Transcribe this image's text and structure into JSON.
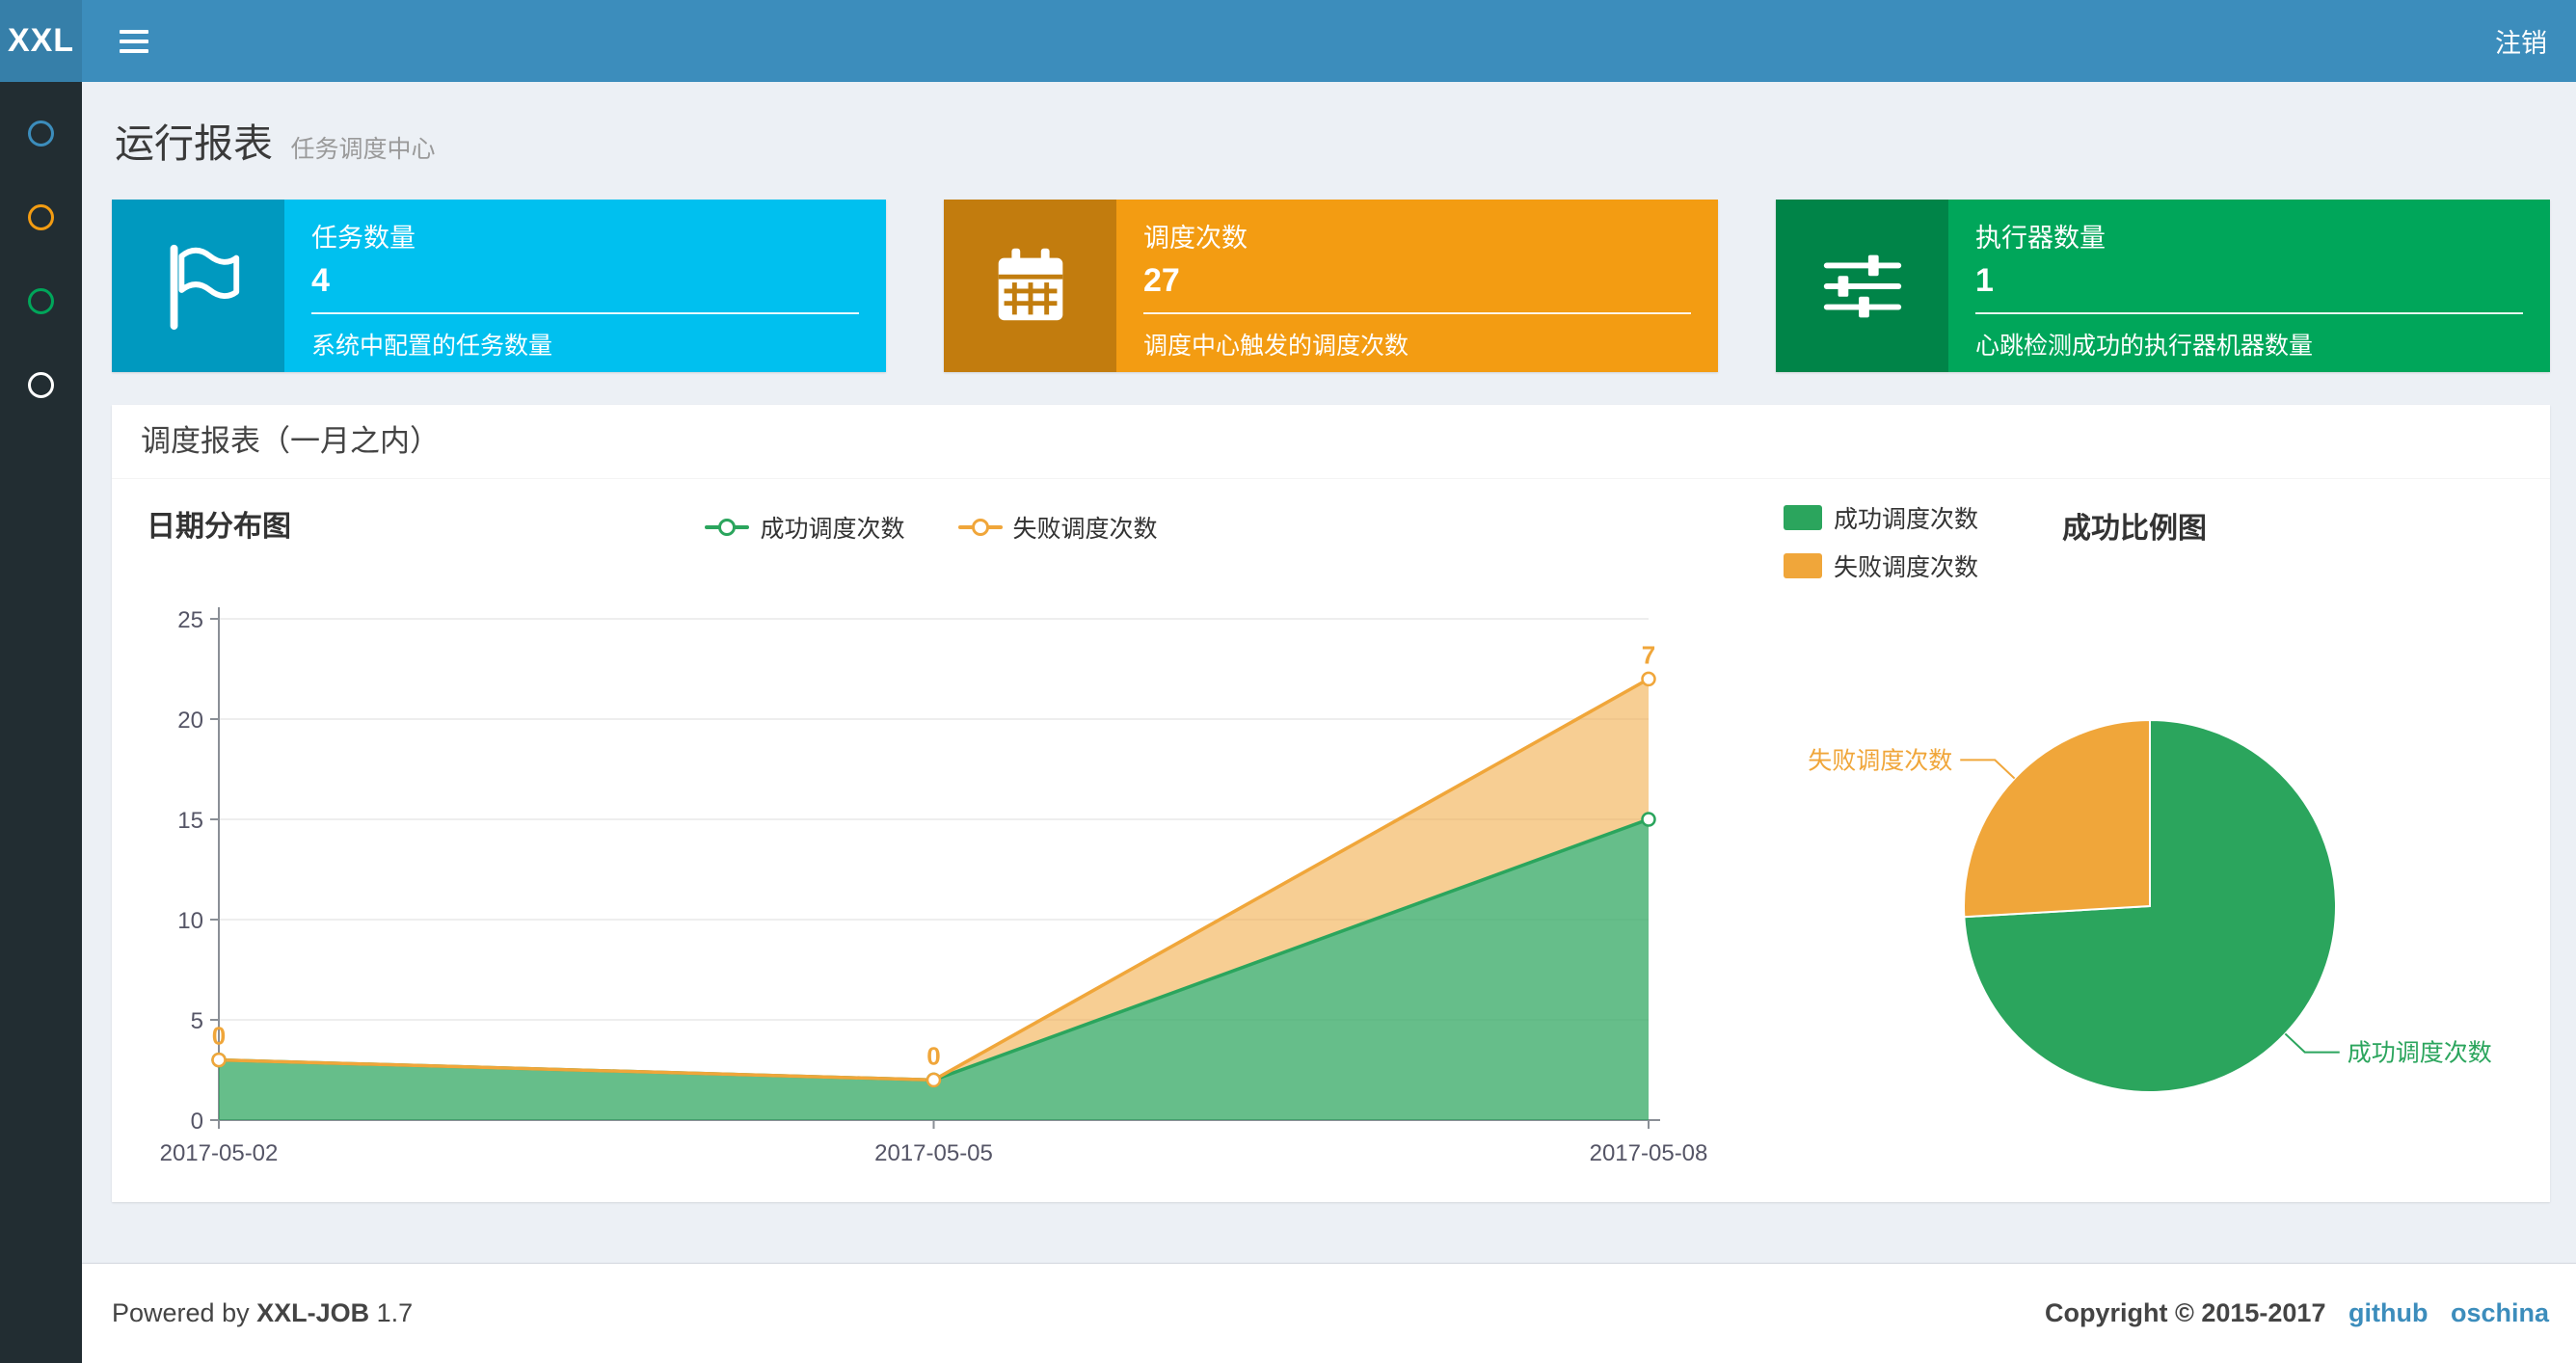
{
  "topbar": {
    "logo": "XXL",
    "logout": "注销"
  },
  "sidebar": {
    "items": [
      {
        "label": "menu-item-1",
        "color": "#3c8dbc"
      },
      {
        "label": "menu-item-2",
        "color": "#f39c12"
      },
      {
        "label": "menu-item-3",
        "color": "#00a65a"
      },
      {
        "label": "menu-item-4",
        "color": "#ffffff"
      }
    ]
  },
  "page": {
    "title": "运行报表",
    "subtitle": "任务调度中心"
  },
  "info_boxes": [
    {
      "label": "任务数量",
      "value": "4",
      "desc": "系统中配置的任务数量",
      "color": "#00c0ef",
      "icon": "flag-icon"
    },
    {
      "label": "调度次数",
      "value": "27",
      "desc": "调度中心触发的调度次数",
      "color": "#f39c12",
      "icon": "calendar-icon"
    },
    {
      "label": "执行器数量",
      "value": "1",
      "desc": "心跳检测成功的执行器机器数量",
      "color": "#00a65a",
      "icon": "sliders-icon"
    }
  ],
  "report": {
    "header": "调度报表（一月之内）"
  },
  "chart_data": [
    {
      "type": "area",
      "title": "日期分布图",
      "x": [
        "2017-05-02",
        "2017-05-05",
        "2017-05-08"
      ],
      "series": [
        {
          "name": "成功调度次数",
          "values": [
            3,
            2,
            15
          ],
          "color": "#2ba55d"
        },
        {
          "name": "失败调度次数",
          "values": [
            0,
            0,
            7
          ],
          "color": "#f0a63a"
        }
      ],
      "stacked": true,
      "ylim": [
        0,
        25
      ],
      "yticks": [
        0,
        5,
        10,
        15,
        20,
        25
      ],
      "xlabel": "",
      "ylabel": "",
      "grid": true,
      "legend_position": "top-center"
    },
    {
      "type": "pie",
      "title": "成功比例图",
      "slices": [
        {
          "name": "成功调度次数",
          "value": 20,
          "color": "#2ba55d"
        },
        {
          "name": "失败调度次数",
          "value": 7,
          "color": "#f0a63a"
        }
      ],
      "legend_position": "top-left"
    }
  ],
  "footer": {
    "powered_prefix": "Powered by",
    "product": "XXL-JOB",
    "version": "1.7",
    "copyright": "Copyright © 2015-2017",
    "links": [
      "github",
      "oschina"
    ]
  }
}
